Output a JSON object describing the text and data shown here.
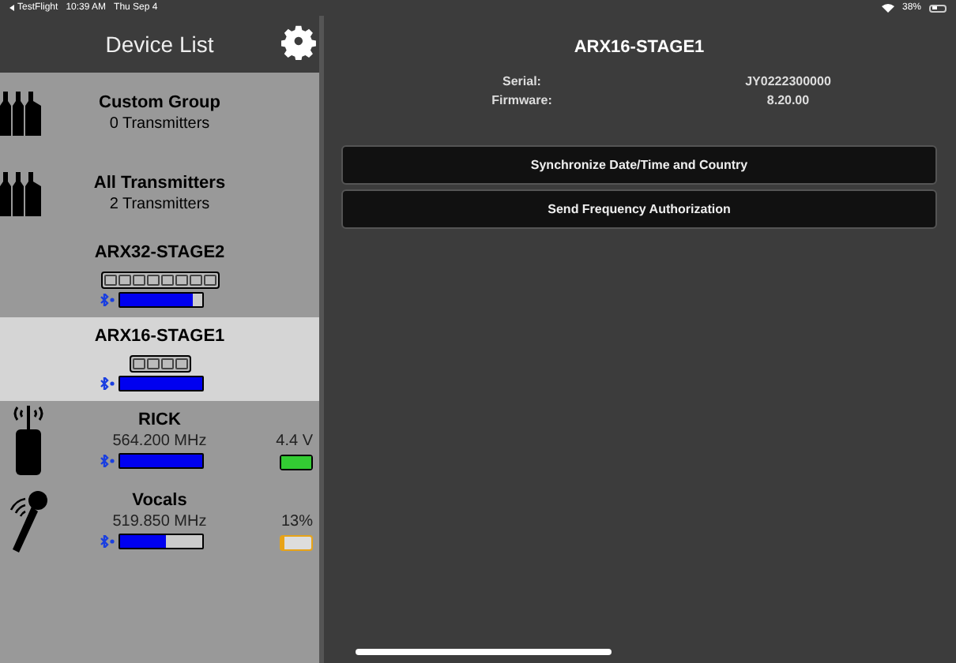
{
  "status_bar": {
    "app": "TestFlight",
    "time": "10:39 AM",
    "date": "Thu Sep 4",
    "battery": "38%"
  },
  "sidebar": {
    "title": "Device List",
    "items": [
      {
        "kind": "group",
        "name": "Custom Group",
        "subtitle": "0 Transmitters",
        "selected": false
      },
      {
        "kind": "group",
        "name": "All Transmitters",
        "subtitle": "2 Transmitters",
        "selected": false
      },
      {
        "kind": "receiver",
        "name": "ARX32-STAGE2",
        "selected": false,
        "slots": [
          {
            "active": false
          },
          {
            "active": false
          },
          {
            "active": false
          },
          {
            "active": false
          },
          {
            "active": false
          },
          {
            "active": false
          },
          {
            "active": false
          },
          {
            "active": false
          }
        ],
        "signal": {
          "level": 0.88
        }
      },
      {
        "kind": "receiver",
        "name": "ARX16-STAGE1",
        "selected": true,
        "slots": [
          {
            "active": false
          },
          {
            "active": false
          },
          {
            "active": false
          },
          {
            "active": false
          }
        ],
        "signal": {
          "level": 1
        }
      },
      {
        "kind": "bodypack",
        "name": "RICK",
        "selected": false,
        "frequency": "564.200 MHz",
        "signal": {
          "level": 1
        },
        "battery": {
          "reading": "4.4 V",
          "level": 1,
          "color": "#33cc33"
        }
      },
      {
        "kind": "handheld",
        "name": "Vocals",
        "selected": false,
        "frequency": "519.850 MHz",
        "signal": {
          "level": 0.55
        },
        "battery": {
          "reading": "13%",
          "level": 0.1,
          "color": "#e8a317"
        }
      }
    ]
  },
  "detail": {
    "title": "ARX16-STAGE1",
    "fields": [
      {
        "label": "Serial:",
        "value": "JY0222300000"
      },
      {
        "label": "Firmware:",
        "value": "8.20.00"
      }
    ],
    "buttons": [
      "Synchronize Date/Time and Country",
      "Send Frequency Authorization"
    ]
  }
}
